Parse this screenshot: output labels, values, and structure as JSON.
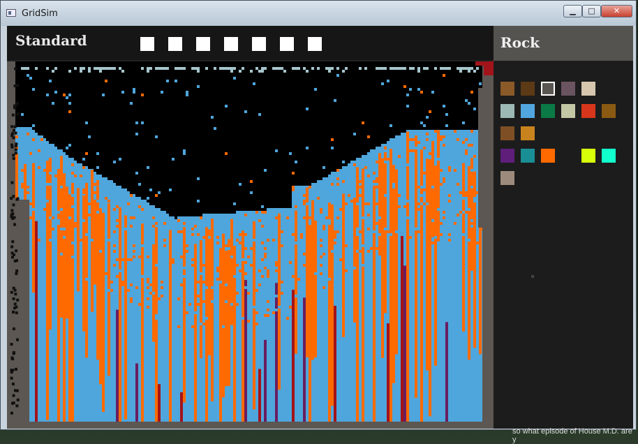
{
  "window": {
    "title": "GridSim",
    "controls": {
      "minimize": "▁",
      "maximize": "□",
      "close": "✕"
    }
  },
  "toolbar": {
    "mode_title": "Standard",
    "tool_squares": 7
  },
  "sidebar": {
    "selected_material": "Rock",
    "selected_index": 2,
    "palette": [
      {
        "color": "#8a5a28"
      },
      {
        "color": "#5c3a15"
      },
      {
        "color": "#5a5652"
      },
      {
        "color": "#6a5460"
      },
      {
        "color": "#d6c7ae"
      },
      {
        "color": "#9cb9b6"
      },
      {
        "color": "#52a6df"
      },
      {
        "color": "#0b7a46"
      },
      {
        "color": "#c3c7a4"
      },
      {
        "color": "#d8361b"
      },
      {
        "color": "#8b5a12"
      },
      {
        "color": "#7e4f25"
      },
      {
        "color": "#c8831e"
      },
      {
        "color": "#5f1e7a"
      },
      {
        "color": "#1a8e95"
      },
      {
        "color": "#ff6a00"
      },
      {
        "color": "#1c1c1c"
      },
      {
        "color": "#d8ff0a"
      },
      {
        "color": "#11ffcc"
      },
      {
        "color": "#9c8b7c"
      }
    ]
  },
  "simulation": {
    "colors": {
      "sky": "#000000",
      "water": "#4fa6dc",
      "lava": "#ff6a00",
      "rock": "#5c5752",
      "deep_red": "#a3131a",
      "purple": "#6a1e60",
      "mist": "#a7c6cd"
    }
  },
  "background_text": "so what episode of House M.D. are y"
}
